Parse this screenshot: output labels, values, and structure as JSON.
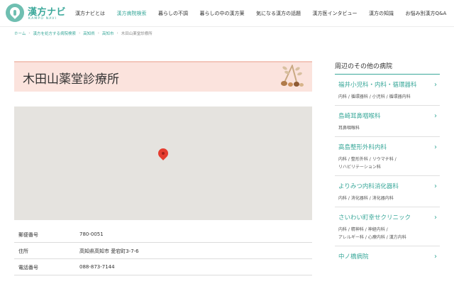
{
  "header": {
    "logo_text": "漢方ナビ",
    "logo_sub": "KAMPO NAVI",
    "nav": [
      {
        "label": "漢方ナビとは",
        "active": false
      },
      {
        "label": "漢方病院検索",
        "active": true
      },
      {
        "label": "暮らしの不調",
        "active": false
      },
      {
        "label": "暮らしの中の漢方薬",
        "active": false
      },
      {
        "label": "気になる漢方の話題",
        "active": false
      },
      {
        "label": "漢方医インタビュー",
        "active": false
      },
      {
        "label": "漢方の知識",
        "active": false
      },
      {
        "label": "お悩み別漢方Q&A",
        "active": false
      }
    ]
  },
  "breadcrumb": {
    "items": [
      "ホーム",
      "漢方を処方する病院検索",
      "高知県",
      "高知市"
    ],
    "current": "木田山薬堂診療所"
  },
  "clinic": {
    "name": "木田山薬堂診療所"
  },
  "info": [
    {
      "label": "郵便番号",
      "value": "780-0051"
    },
    {
      "label": "住所",
      "value": "高知県高知市 愛宕町3-7-6"
    },
    {
      "label": "電話番号",
      "value": "088-873-7144"
    }
  ],
  "sidebar": {
    "title": "周辺のその他の病院",
    "items": [
      {
        "name": "福井小児科・内科・循環器科",
        "tags": [
          "内科 /",
          "循環器科 /",
          "小児科 /",
          "循環器内科"
        ]
      },
      {
        "name": "島崎耳鼻咽喉科",
        "tags": [
          "耳鼻咽喉科"
        ]
      },
      {
        "name": "高島整形外科内科",
        "tags": [
          "内科 /",
          "整形外科 /",
          "リウマチ科 /",
          "リハビリテーション科"
        ]
      },
      {
        "name": "よりみつ内科消化器科",
        "tags": [
          "内科 /",
          "消化器科 /",
          "消化器内科"
        ]
      },
      {
        "name": "さいわい町幸せクリニック",
        "tags": [
          "内科 /",
          "精神科 /",
          "神経内科 /",
          "アレルギー科 /",
          "心療内科 /",
          "漢方内科"
        ]
      },
      {
        "name": "中ノ橋病院",
        "tags": []
      }
    ]
  },
  "colors": {
    "accent": "#3aa89a",
    "banner": "#fbe3dd",
    "pin": "#e53d30",
    "map_bg": "#e5e3df"
  },
  "icons": {
    "pin": "map-pin-icon",
    "chevron": "chevron-right-icon",
    "logo": "kampo-leaf-logo"
  }
}
